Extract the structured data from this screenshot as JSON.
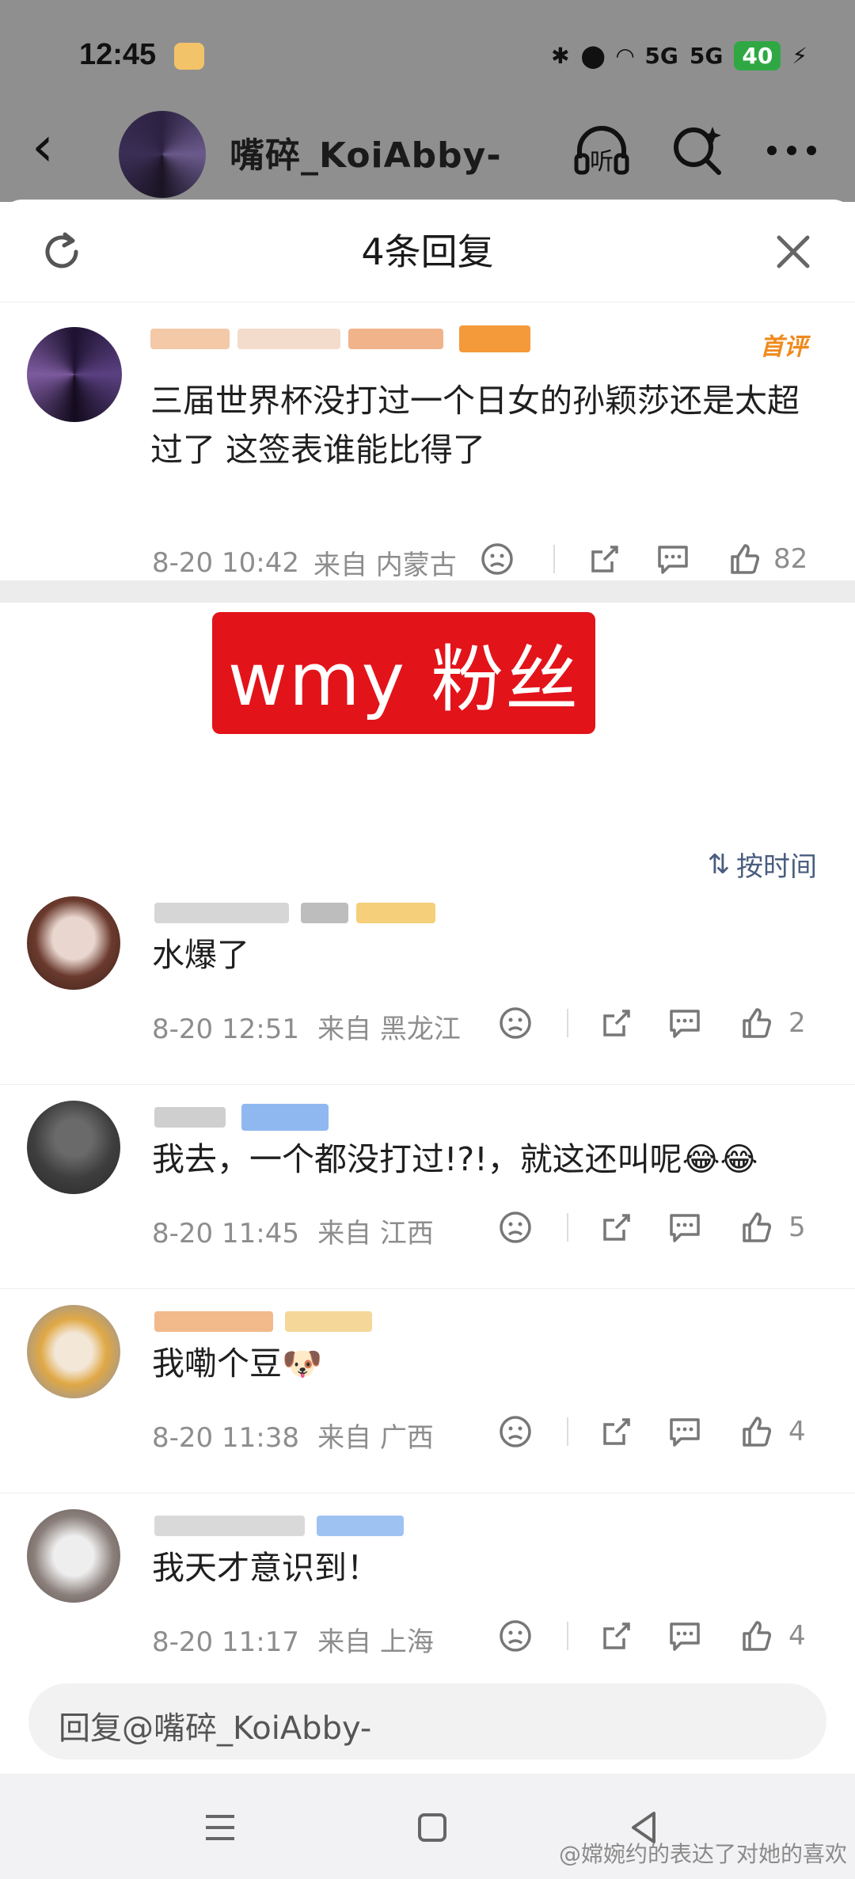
{
  "status_bar": {
    "time": "12:45",
    "battery": "40",
    "signal1": "5G",
    "signal2": "5G"
  },
  "header": {
    "title": "嘴碎_KoiAbby-",
    "listen_label": "听"
  },
  "sheet": {
    "title": "4条回复"
  },
  "main_comment": {
    "badge": "首评",
    "text": "三届世界杯没打过一个日女的孙颖莎还是太超过了 这签表谁能比得了",
    "time": "8-20 10:42",
    "location": "来自 内蒙古",
    "likes": "82"
  },
  "overlay_label": "wmy 粉丝",
  "sort_label": "按时间",
  "replies": [
    {
      "text": "水爆了",
      "time": "8-20 12:51",
      "location": "来自 黑龙江",
      "likes": "2"
    },
    {
      "text": "我去，一个都没打过!?!，就这还叫呢😂😂",
      "time": "8-20 11:45",
      "location": "来自 江西",
      "likes": "5"
    },
    {
      "text": "我嘞个豆🐶",
      "time": "8-20 11:38",
      "location": "来自 广西",
      "likes": "4"
    },
    {
      "text": "我天才意识到！",
      "time": "8-20 11:17",
      "location": "来自 上海",
      "likes": "4"
    }
  ],
  "reply_input": {
    "placeholder": "回复@嘴碎_KoiAbby-"
  },
  "watermark": "@嫦婉约的表达了对她的喜欢",
  "colors": {
    "accent_red": "#e3131a",
    "badge_orange": "#f08a1c",
    "sort_blue": "#4a5d80"
  }
}
